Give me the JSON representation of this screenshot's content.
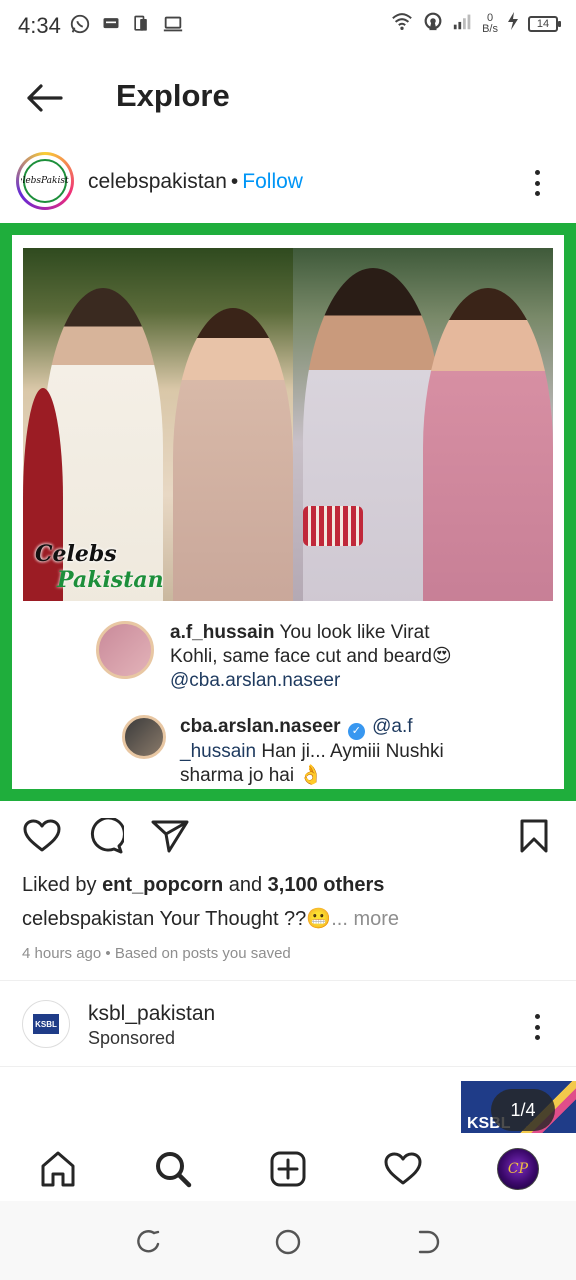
{
  "status_bar": {
    "time": "4:34",
    "net_speed_value": "0",
    "net_speed_unit": "B/s",
    "battery_level": "14",
    "icons": [
      "whatsapp-icon",
      "message-icon",
      "sim-icon",
      "laptop-icon",
      "wifi-icon",
      "hotspot-icon",
      "signal-icon",
      "charging-icon",
      "battery-icon"
    ]
  },
  "header": {
    "title": "Explore",
    "back_icon": "arrow-left-icon"
  },
  "post": {
    "username": "celebspakistan",
    "separator": "•",
    "follow_label": "Follow",
    "avatar_text_top": "Celebs",
    "avatar_text_bottom": "Pakistan",
    "watermark_top": "Celebs",
    "watermark_bottom": "Pakistan",
    "comment1": {
      "user": "a.f_hussain",
      "text": " You look like Virat Kohli, same face cut and beard😍",
      "mention": "@cba.arslan.naseer"
    },
    "comment2": {
      "user": "cba.arslan.naseer",
      "mention": "@a.f _hussain",
      "text": " Han ji... Aymiii Nushki sharma jo hai 👌"
    },
    "likes_prefix": "Liked by ",
    "likes_user": "ent_popcorn",
    "likes_and": " and ",
    "likes_count": "3,100 others",
    "caption_user": "celebspakistan",
    "caption_text": " Your Thought ??😬",
    "caption_more": "... more",
    "meta": "4 hours ago • Based on posts you saved",
    "frame_color": "#1fae3c"
  },
  "sponsored": {
    "username": "ksbl_pakistan",
    "label": "Sponsored",
    "avatar_text": "KSBL",
    "preview_text": "KSBL",
    "counter": "1/4"
  },
  "bottom_nav": {
    "items": [
      "home-icon",
      "search-icon",
      "add-post-icon",
      "activity-heart-icon",
      "profile-avatar"
    ],
    "profile_text": "CP"
  },
  "colors": {
    "accent": "#0095f6",
    "text": "#262626",
    "muted": "#8e8e8e"
  }
}
